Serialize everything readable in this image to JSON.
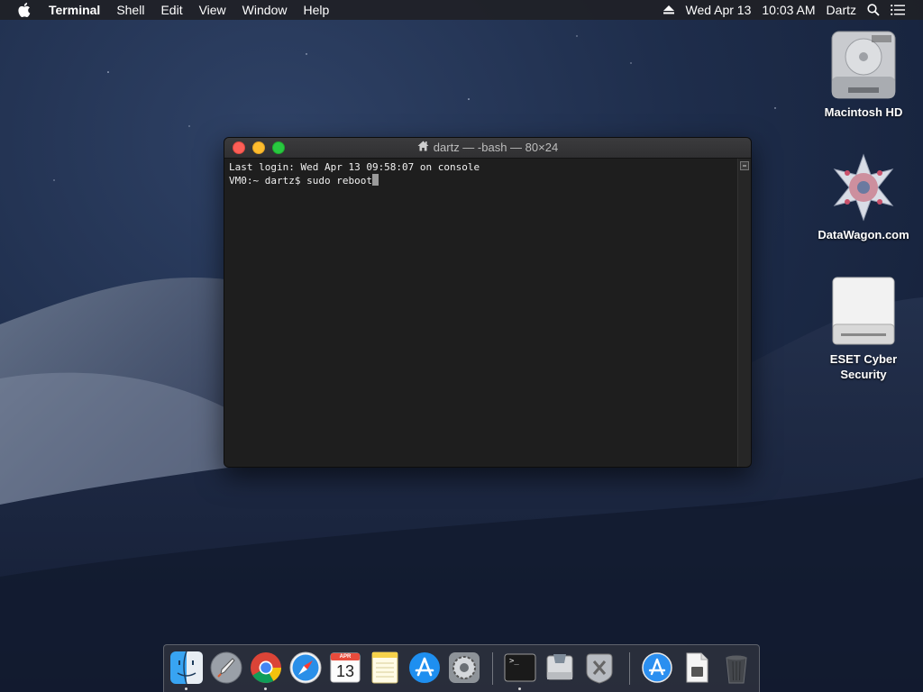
{
  "menubar": {
    "app_name": "Terminal",
    "items": [
      "Shell",
      "Edit",
      "View",
      "Window",
      "Help"
    ],
    "date": "Wed Apr 13",
    "time": "10:03 AM",
    "user": "Dartz"
  },
  "desktop": {
    "icons": [
      {
        "label": "Macintosh HD"
      },
      {
        "label": "DataWagon.com"
      },
      {
        "label": "ESET Cyber Security"
      }
    ]
  },
  "terminal": {
    "title": "dartz — -bash — 80×24",
    "lines": [
      "Last login: Wed Apr 13 09:58:07 on console",
      "VM0:~ dartz$ sudo reboot"
    ]
  },
  "dock": {
    "calendar_month": "APR",
    "calendar_day": "13",
    "terminal_glyph": ">_",
    "items": [
      "finder-icon",
      "launchpad-icon",
      "chrome-icon",
      "safari-icon",
      "calendar-icon",
      "notes-icon",
      "app-store-icon",
      "system-preferences-icon",
      "terminal-icon",
      "disk-utility-icon",
      "directory-utility-icon",
      "app-store-downloads-icon",
      "document-icon",
      "trash-icon"
    ]
  },
  "colors": {
    "close": "#fc5f57",
    "minimize": "#fdbc2e",
    "maximize": "#28c840",
    "terminal_bg": "#1e1e1e"
  }
}
